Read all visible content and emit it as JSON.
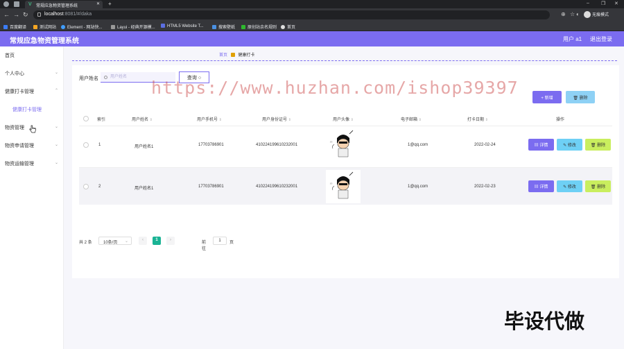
{
  "browser": {
    "tab_title": "常规应急物资管理系统",
    "url_host": "localhost",
    "url_path": ":8081/#/daka",
    "profile": "无痕模式",
    "bookmarks": [
      "百度翻译",
      "测试网站",
      "Element - 网站快...",
      "Layui - 经典开源模...",
      "HTML5 Website T...",
      "搜索壁纸",
      "原创站余名规则",
      "首页"
    ]
  },
  "header": {
    "title": "常规应急物资管理系统",
    "user": "用户 a1",
    "logout": "退出登录"
  },
  "sidebar": {
    "items": [
      "首页",
      "个人中心",
      "健康打卡管理",
      "健康打卡管理",
      "物资管理",
      "物资申请管理",
      "物资运输管理"
    ]
  },
  "breadcrumb": {
    "home": "首页",
    "current": "健康打卡"
  },
  "search": {
    "label": "用户姓名",
    "placeholder": "用户姓名",
    "button": "查询"
  },
  "actions": {
    "add": "+ 新增",
    "delete": "删除"
  },
  "table": {
    "headers": [
      "索引",
      "用户姓名",
      "用户手机号",
      "用户身份证号",
      "用户头像",
      "电子邮箱",
      "打卡日期",
      "操作"
    ],
    "rows": [
      {
        "index": "1",
        "name": "用户姓名1",
        "phone": "17703786901",
        "idcard": "410224199610232001",
        "email": "1@qq.com",
        "date": "2022-02-24"
      },
      {
        "index": "2",
        "name": "用户姓名1",
        "phone": "17703786901",
        "idcard": "410224199610232001",
        "email": "1@qq.com",
        "date": "2022-02-23"
      }
    ],
    "ops": {
      "detail": "详情",
      "edit": "修改",
      "remove": "删除"
    }
  },
  "pager": {
    "total": "共 2 条",
    "size": "10条/页",
    "current": "1",
    "goto": "前往",
    "goto_value": "1",
    "page": "页"
  },
  "watermark": "https://www.huzhan.com/ishop39397",
  "brand": "毕设代做",
  "colors": {
    "primary": "#7b6cf0",
    "info": "#6ed0f5",
    "lime": "#c9ee5e",
    "pager": "#1ab394"
  }
}
